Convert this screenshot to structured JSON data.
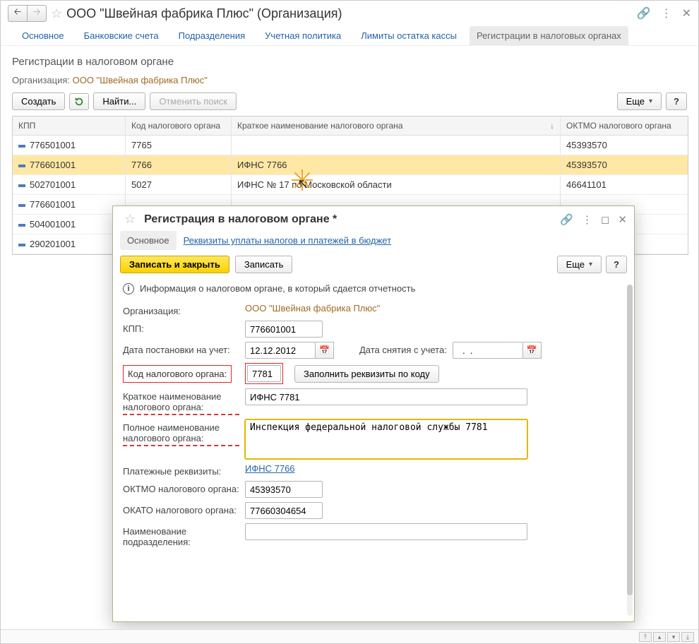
{
  "header": {
    "title": "ООО \"Швейная фабрика Плюс\" (Организация)"
  },
  "tabs": [
    {
      "label": "Основное"
    },
    {
      "label": "Банковские счета"
    },
    {
      "label": "Подразделения"
    },
    {
      "label": "Учетная политика"
    },
    {
      "label": "Лимиты остатка кассы"
    },
    {
      "label": "Регистрации в налоговых органах",
      "active": true
    }
  ],
  "section": {
    "title": "Регистрации в налоговом органе",
    "org_label": "Организация:",
    "org_value": "ООО \"Швейная фабрика Плюс\"",
    "btn_create": "Создать",
    "btn_find": "Найти...",
    "btn_cancel_search": "Отменить поиск",
    "btn_more": "Еще",
    "btn_help": "?"
  },
  "grid": {
    "columns": [
      "КПП",
      "Код налогового органа",
      "Краткое наименование налогового органа",
      "ОКТМО налогового органа"
    ],
    "rows": [
      {
        "kpp": "776501001",
        "code": "7765",
        "short": "",
        "oktmo": "45393570"
      },
      {
        "kpp": "776601001",
        "code": "7766",
        "short": "ИФНС 7766",
        "oktmo": "45393570",
        "selected": true
      },
      {
        "kpp": "502701001",
        "code": "5027",
        "short": "ИФНС № 17 по Московской области",
        "oktmo": "46641101"
      },
      {
        "kpp": "776601001",
        "code": "",
        "short": "",
        "oktmo": ""
      },
      {
        "kpp": "504001001",
        "code": "",
        "short": "",
        "oktmo": ""
      },
      {
        "kpp": "290201001",
        "code": "",
        "short": "",
        "oktmo": ""
      }
    ]
  },
  "modal": {
    "title": "Регистрация в налоговом органе *",
    "tabs": [
      {
        "label": "Основное",
        "active": true
      },
      {
        "label": "Реквизиты уплаты налогов и платежей в бюджет"
      }
    ],
    "btn_save_close": "Записать и закрыть",
    "btn_save": "Записать",
    "btn_more": "Еще",
    "btn_help": "?",
    "info_text": "Информация о налоговом органе, в который сдается отчетность",
    "fields": {
      "org_label": "Организация:",
      "org_value": "ООО \"Швейная фабрика Плюс\"",
      "kpp_label": "КПП:",
      "kpp_value": "776601001",
      "reg_date_label": "Дата постановки на учет:",
      "reg_date_value": "12.12.2012",
      "dereg_date_label": "Дата снятия с учета:",
      "dereg_date_value": "  .  .    ",
      "tax_code_label": "Код налогового органа:",
      "tax_code_value": "7781",
      "fill_by_code_btn": "Заполнить реквизиты по коду",
      "short_name_label": "Краткое наименование налогового органа:",
      "short_name_value": "ИФНС 7781",
      "full_name_label": "Полное наименование налогового органа:",
      "full_name_value": "Инспекция федеральной налоговой службы 7781",
      "pay_req_label": "Платежные реквизиты:",
      "pay_req_link": "ИФНС 7766",
      "oktmo_label": "ОКТМО налогового органа:",
      "oktmo_value": "45393570",
      "okato_label": "ОКАТО налогового органа:",
      "okato_value": "77660304654",
      "subdiv_label": "Наименование подразделения:",
      "subdiv_value": ""
    }
  }
}
